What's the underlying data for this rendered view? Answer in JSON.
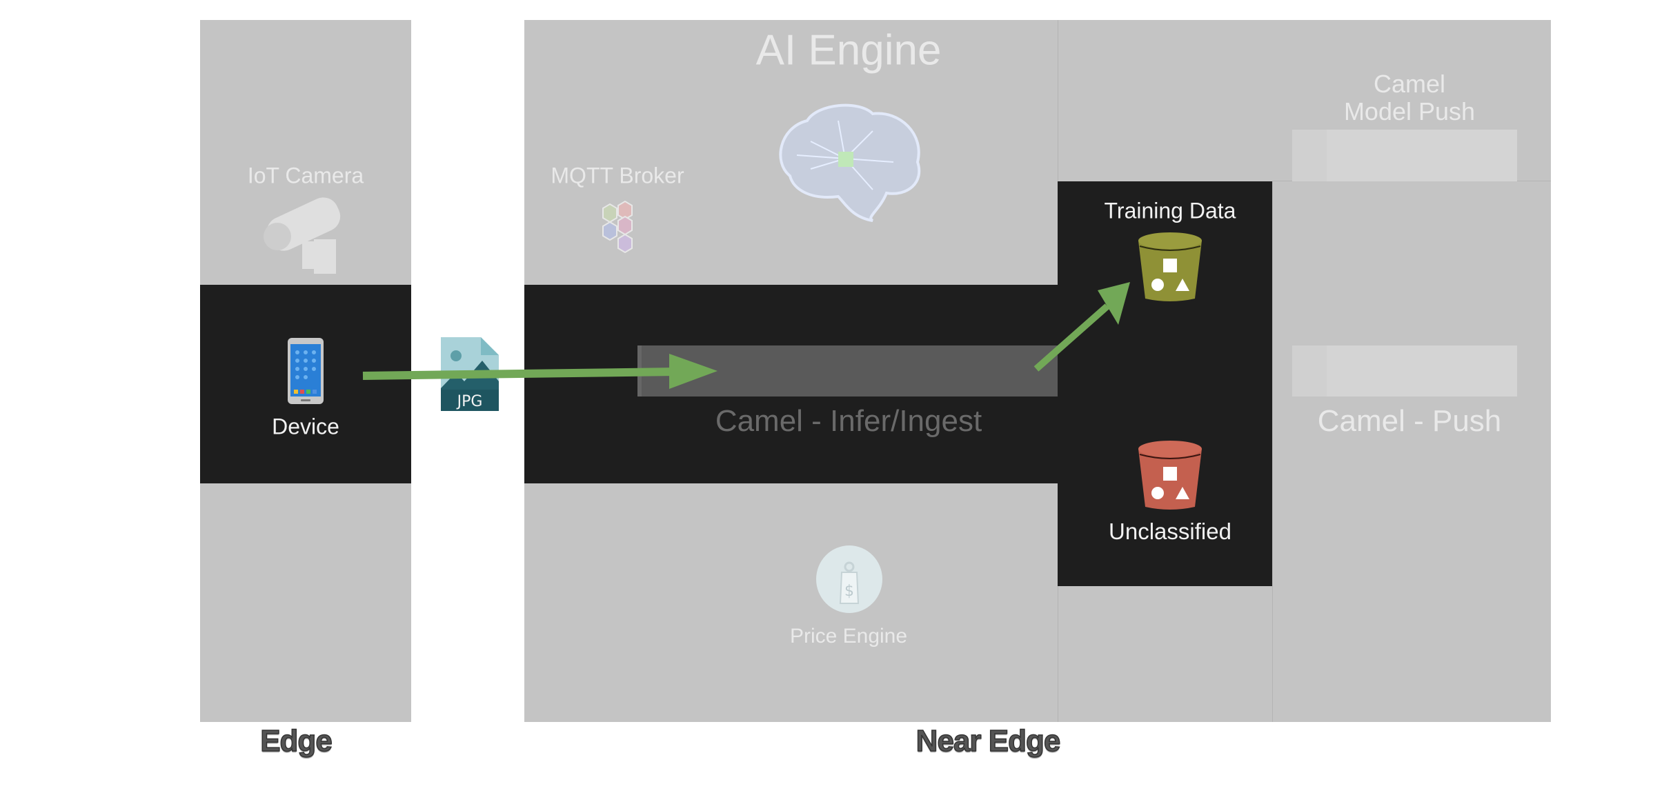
{
  "zones": {
    "edge": "Edge",
    "near_edge": "Near Edge"
  },
  "edge": {
    "iot_camera": {
      "label": "IoT Camera",
      "icon": "security-camera-icon"
    },
    "device": {
      "label": "Device",
      "icon": "smartphone-icon"
    }
  },
  "payload": {
    "label": "JPG",
    "icon": "image-file-icon"
  },
  "near_edge": {
    "ai_engine": {
      "title": "AI Engine",
      "icon": "brain-circuit-icon"
    },
    "mqtt_broker": {
      "label": "MQTT Broker",
      "icon": "hexagon-network-icon"
    },
    "camel_infer": {
      "label": "Camel - Infer/Ingest"
    },
    "price_engine": {
      "label": "Price Engine",
      "icon": "price-tag-icon"
    },
    "training_data": {
      "label": "Training Data",
      "icon": "bucket-icon",
      "color": "#8f9136"
    },
    "unclassified": {
      "label": "Unclassified",
      "icon": "bucket-icon",
      "color": "#c4604f"
    },
    "camel_model_push": {
      "line1": "Camel",
      "line2": "Model Push"
    },
    "camel_push": {
      "label": "Camel - Push"
    }
  },
  "colors": {
    "panel": "#c4c4c4",
    "highlight_band": "#1e1e1e",
    "flow_arrow": "#72a857"
  }
}
